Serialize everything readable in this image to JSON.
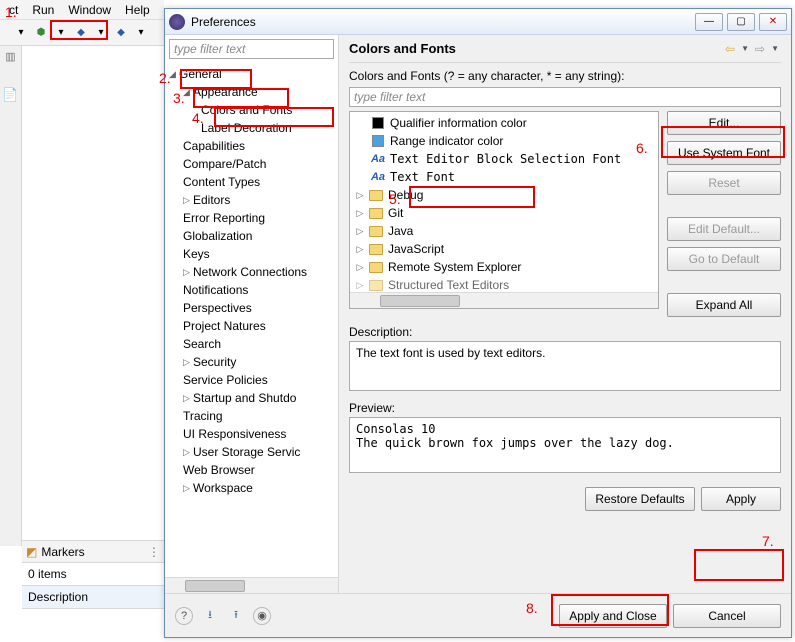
{
  "bg": {
    "menu": {
      "ct": "ct",
      "run": "Run",
      "window": "Window",
      "help": "Help"
    },
    "markers": {
      "tab": "Markers",
      "items": "0 items",
      "desc_col": "Description"
    }
  },
  "dlg": {
    "caption": "Preferences",
    "filter_placeholder": "type filter text",
    "tree": {
      "general": "General",
      "appearance": "Appearance",
      "colors_fonts": "Colors and Fonts",
      "label_dec": "Label Decoration",
      "capabilities": "Capabilities",
      "compare_patch": "Compare/Patch",
      "content_types": "Content Types",
      "editors": "Editors",
      "error_reporting": "Error Reporting",
      "globalization": "Globalization",
      "keys": "Keys",
      "network": "Network Connections",
      "notifications": "Notifications",
      "perspectives": "Perspectives",
      "project_natures": "Project Natures",
      "search": "Search",
      "security": "Security",
      "service_policies": "Service Policies",
      "startup": "Startup and Shutdo",
      "tracing": "Tracing",
      "ui_resp": "UI Responsiveness",
      "user_storage": "User Storage Servic",
      "web_browser": "Web Browser",
      "workspace": "Workspace"
    },
    "main": {
      "title": "Colors and Fonts",
      "subtitle": "Colors and Fonts (? = any character, * = any string):",
      "list_filter_placeholder": "type filter text",
      "rows": {
        "qualifier": "Qualifier information color",
        "range": "Range indicator color",
        "block_sel": "Text Editor Block Selection Font",
        "text_font": "Text Font",
        "debug": "Debug",
        "git": "Git",
        "java": "Java",
        "javascript": "JavaScript",
        "remote": "Remote System Explorer",
        "structured": "Structured Text Editors"
      },
      "btns": {
        "edit": "Edit...",
        "use_sys": "Use System Font",
        "reset": "Reset",
        "edit_def": "Edit Default...",
        "goto_def": "Go to Default",
        "expand_all": "Expand All"
      },
      "desc_label": "Description:",
      "desc_text": "The text font is used by text editors.",
      "prev_label": "Preview:",
      "prev_text": "Consolas 10\nThe quick brown fox jumps over the lazy dog.",
      "restore_defaults": "Restore Defaults",
      "apply": "Apply"
    },
    "footer": {
      "apply_close": "Apply and Close",
      "cancel": "Cancel"
    }
  },
  "annotations": {
    "n1": "1.",
    "n2": "2.",
    "n3": "3.",
    "n4": "4.",
    "n5": "5.",
    "n6": "6.",
    "n7": "7.",
    "n8": "8."
  }
}
